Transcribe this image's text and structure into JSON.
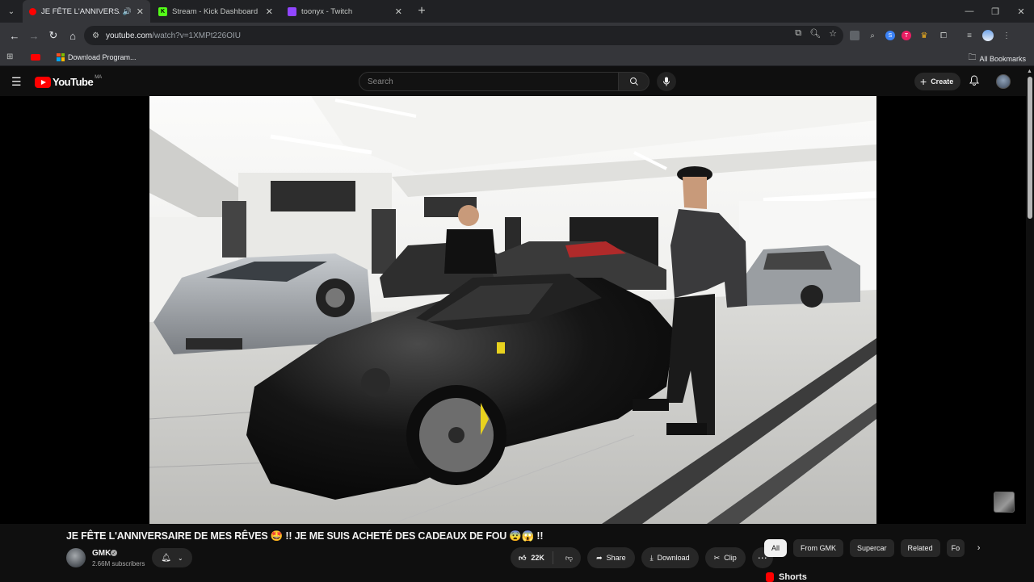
{
  "browser": {
    "tabs": [
      {
        "title": "JE FÊTE L'ANNIVERSAIRE DE",
        "active": true,
        "favicon_color": "#ff0000",
        "audio": true
      },
      {
        "title": "Stream - Kick Dashboard",
        "active": false,
        "favicon_color": "#53fc18",
        "favicon_letter": "K"
      },
      {
        "title": "toonyx - Twitch",
        "active": false,
        "favicon_color": "#9146ff"
      }
    ],
    "url_host": "youtube.com",
    "url_path": "/watch?v=1XMPt226OIU",
    "bookmarks": [
      {
        "label": ""
      },
      {
        "label": "Download Program..."
      }
    ],
    "all_bookmarks_label": "All Bookmarks"
  },
  "youtube": {
    "logo_text": "YouTube",
    "country_code": "MA",
    "search_placeholder": "Search",
    "create_label": "Create",
    "video": {
      "title": "JE FÊTE L'ANNIVERSAIRE DE MES RÊVES 🤩 !! JE ME SUIS ACHETÉ DES CADEAUX DE FOU 😨😱 !!",
      "channel_name": "GMK",
      "subscribers": "2.66M subscribers",
      "likes": "22K",
      "share_label": "Share",
      "download_label": "Download",
      "clip_label": "Clip"
    },
    "chips": [
      "All",
      "From GMK",
      "Supercar",
      "Related",
      "Fo"
    ],
    "active_chip": "All",
    "shorts_label": "Shorts"
  },
  "colors": {
    "yt_red": "#ff0000",
    "background": "#0f0f0f",
    "pill": "#272727",
    "chrome_dark": "#202124",
    "chrome_toolbar": "#35363a"
  }
}
